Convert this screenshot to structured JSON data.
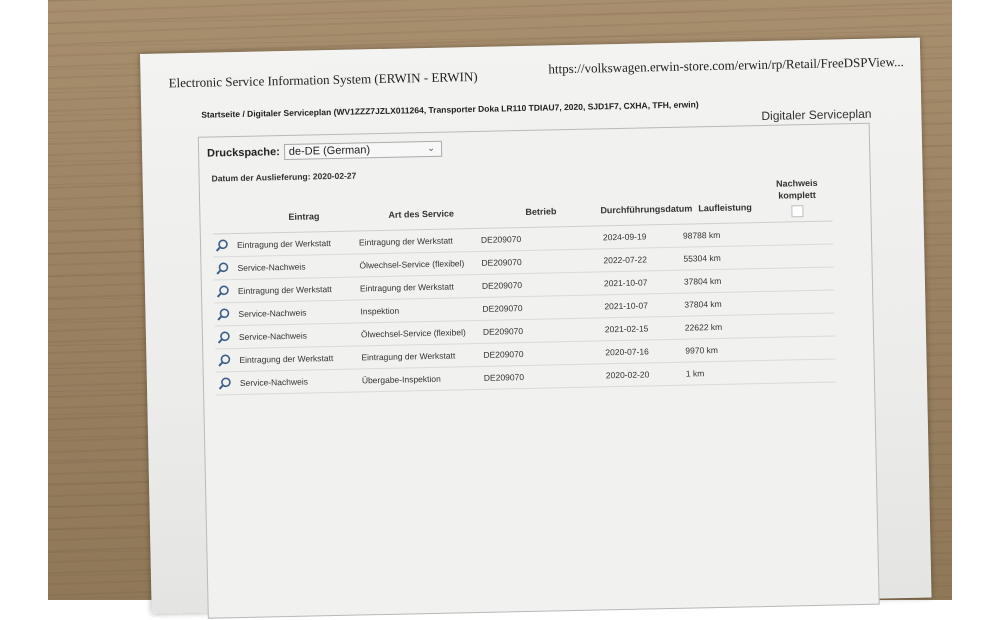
{
  "header": {
    "app_title": "Electronic Service Information System (ERWIN - ERWIN)",
    "url": "https://volkswagen.erwin-store.com/erwin/rp/Retail/FreeDSPView..."
  },
  "breadcrumb": {
    "home": "Startseite",
    "separator": " / ",
    "current": "Digitaler Serviceplan (WV1ZZZ7JZLX011264, Transporter Doka LR110 TDIAU7, 2020, SJD1F7, CXHA, TFH, erwin)"
  },
  "panel": {
    "title": "Digitaler Serviceplan",
    "language_label": "Druckspache:",
    "language_value": "de-DE (German)",
    "delivery_date_label": "Datum der Auslieferung: 2020-02-27"
  },
  "table": {
    "columns": {
      "eintrag": "Eintrag",
      "art": "Art des Service",
      "betrieb": "Betrieb",
      "datum": "Durchführungsdatum",
      "laufleistung": "Laufleistung",
      "nachweis_line1": "Nachweis",
      "nachweis_line2": "komplett"
    },
    "rows": [
      {
        "eintrag": "Eintragung der Werkstatt",
        "art": "Eintragung der Werkstatt",
        "betrieb": "DE209070",
        "datum": "2024-09-19",
        "laufleistung": "98788 km"
      },
      {
        "eintrag": "Service-Nachweis",
        "art": "Ölwechsel-Service (flexibel)",
        "betrieb": "DE209070",
        "datum": "2022-07-22",
        "laufleistung": "55304 km"
      },
      {
        "eintrag": "Eintragung der Werkstatt",
        "art": "Eintragung der Werkstatt",
        "betrieb": "DE209070",
        "datum": "2021-10-07",
        "laufleistung": "37804 km"
      },
      {
        "eintrag": "Service-Nachweis",
        "art": "Inspektion",
        "betrieb": "DE209070",
        "datum": "2021-10-07",
        "laufleistung": "37804 km"
      },
      {
        "eintrag": "Service-Nachweis",
        "art": "Ölwechsel-Service (flexibel)",
        "betrieb": "DE209070",
        "datum": "2021-02-15",
        "laufleistung": "22622 km"
      },
      {
        "eintrag": "Eintragung der Werkstatt",
        "art": "Eintragung der Werkstatt",
        "betrieb": "DE209070",
        "datum": "2020-07-16",
        "laufleistung": "9970 km"
      },
      {
        "eintrag": "Service-Nachweis",
        "art": "Übergabe-Inspektion",
        "betrieb": "DE209070",
        "datum": "2020-02-20",
        "laufleistung": "1 km"
      }
    ]
  },
  "icons": {
    "row_icon": "magnifier-icon",
    "select_icon": "chevron-down-icon"
  },
  "colors": {
    "magnifier": "#3b5f8a"
  }
}
